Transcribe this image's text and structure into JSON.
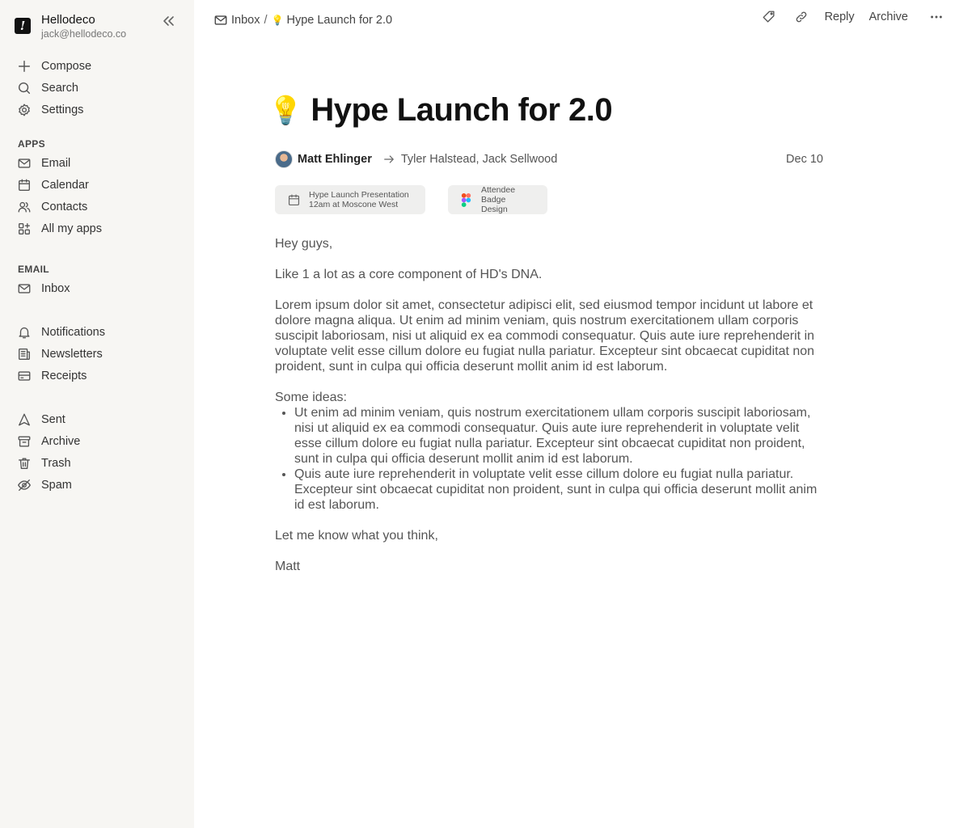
{
  "account": {
    "name": "Hellodeco",
    "email": "jack@hellodeco.co",
    "logo_glyph": "!"
  },
  "sidebar": {
    "top_items": [
      {
        "label": "Compose",
        "icon": "plus-icon"
      },
      {
        "label": "Search",
        "icon": "search-icon"
      },
      {
        "label": "Settings",
        "icon": "gear-icon"
      }
    ],
    "apps_label": "APPS",
    "apps": [
      {
        "label": "Email",
        "icon": "mail-icon"
      },
      {
        "label": "Calendar",
        "icon": "calendar-icon"
      },
      {
        "label": "Contacts",
        "icon": "users-icon"
      },
      {
        "label": "All my apps",
        "icon": "apps-plus-icon"
      }
    ],
    "email_label": "EMAIL",
    "email_items": [
      {
        "label": "Inbox",
        "icon": "mail-icon"
      }
    ],
    "filters": [
      {
        "label": "Notifications",
        "icon": "bell-icon"
      },
      {
        "label": "Newsletters",
        "icon": "newspaper-icon"
      },
      {
        "label": "Receipts",
        "icon": "credit-card-icon"
      }
    ],
    "folders": [
      {
        "label": "Sent",
        "icon": "send-icon"
      },
      {
        "label": "Archive",
        "icon": "archive-icon"
      },
      {
        "label": "Trash",
        "icon": "trash-icon"
      },
      {
        "label": "Spam",
        "icon": "eye-off-icon"
      }
    ]
  },
  "breadcrumb": {
    "root": "Inbox",
    "separator": "/",
    "emoji": "💡",
    "current": "Hype Launch for 2.0"
  },
  "toolbar": {
    "reply_label": "Reply",
    "archive_label": "Archive"
  },
  "email": {
    "emoji": "💡",
    "subject": "Hype Launch for 2.0",
    "sender": "Matt Ehlinger",
    "recipients": "Tyler Halstead, Jack Sellwood",
    "date": "Dec 10",
    "attachments": [
      {
        "line1": "Hype Launch Presentation",
        "line2": "12am at Moscone West",
        "icon": "calendar-icon"
      },
      {
        "line1": "Attendee Badge",
        "line2": "Design",
        "icon": "figma-icon"
      }
    ],
    "greeting": "Hey guys,",
    "para1": "Like 1 a lot as a core component of HD's DNA.",
    "para2": "Lorem ipsum dolor sit amet, consectetur adipisci elit, sed eiusmod tempor incidunt ut labore et dolore magna aliqua. Ut enim ad minim veniam, quis nostrum exercitationem ullam corporis suscipit laboriosam, nisi ut aliquid ex ea commodi consequatur. Quis aute iure reprehenderit in voluptate velit esse cillum dolore eu fugiat nulla pariatur. Excepteur sint obcaecat cupiditat non proident, sunt in culpa qui officia deserunt mollit anim id est laborum.",
    "ideas_label": "Some ideas:",
    "ideas": [
      "Ut enim ad minim veniam, quis nostrum exercitationem ullam corporis suscipit laboriosam, nisi ut aliquid ex ea commodi consequatur. Quis aute iure reprehenderit in voluptate velit esse cillum dolore eu fugiat nulla pariatur. Excepteur sint obcaecat cupiditat non proident, sunt in culpa qui officia deserunt mollit anim id est laborum.",
      "Quis aute iure reprehenderit in voluptate velit esse cillum dolore eu fugiat nulla pariatur. Excepteur sint obcaecat cupiditat non proident, sunt in culpa qui officia deserunt mollit anim id est laborum."
    ],
    "closing": "Let me know what you think,",
    "signature": "Matt"
  }
}
